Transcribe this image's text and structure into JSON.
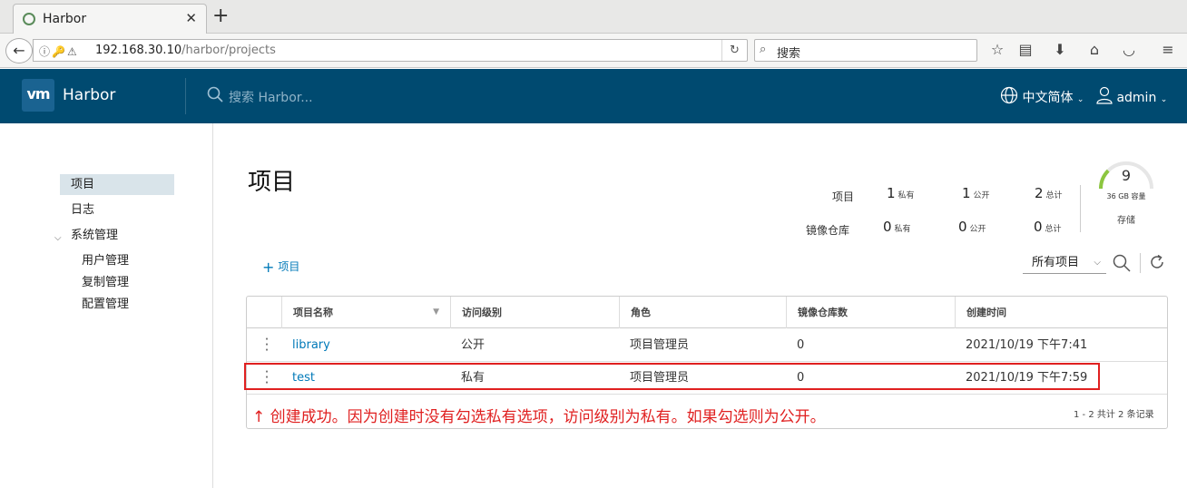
{
  "browser": {
    "tab_title": "Harbor",
    "url_host": "192.168.30.10",
    "url_path": "/harbor/projects",
    "search_placeholder": "搜索"
  },
  "header": {
    "brand": "Harbor",
    "logo_text": "vm",
    "search_placeholder": "搜索 Harbor...",
    "language": "中文简体",
    "user": "admin"
  },
  "sidebar": {
    "items": [
      {
        "label": "项目",
        "active": true
      },
      {
        "label": "日志"
      },
      {
        "label": "系统管理"
      }
    ],
    "sub_items": [
      "用户管理",
      "复制管理",
      "配置管理"
    ]
  },
  "main": {
    "title": "项目",
    "stats": {
      "row1_label": "项目",
      "row2_label": "镜像仓库",
      "projects": {
        "private": "1",
        "public": "1",
        "total": "2"
      },
      "repos": {
        "private": "0",
        "public": "0",
        "total": "0"
      },
      "unit_private": "私有",
      "unit_public": "公开",
      "unit_total": "总计"
    },
    "storage": {
      "value": "9",
      "capacity": "36 GB 容量",
      "label": "存储",
      "used_fraction": 0.25,
      "color": "#8cc63f"
    },
    "add_project_label": "项目",
    "filter_value": "所有项目"
  },
  "table": {
    "columns": [
      "项目名称",
      "访问级别",
      "角色",
      "镜像仓库数",
      "创建时间"
    ],
    "rows": [
      {
        "name": "library",
        "access": "公开",
        "role": "项目管理员",
        "repos": "0",
        "created": "2021/10/19 下午7:41"
      },
      {
        "name": "test",
        "access": "私有",
        "role": "项目管理员",
        "repos": "0",
        "created": "2021/10/19 下午7:59"
      }
    ],
    "pagination": "1 - 2 共计 2 条记录"
  },
  "annotation": {
    "text": "↑ 创建成功。因为创建时没有勾选私有选项，访问级别为私有。如果勾选则为公开。",
    "color": "#e02020"
  }
}
